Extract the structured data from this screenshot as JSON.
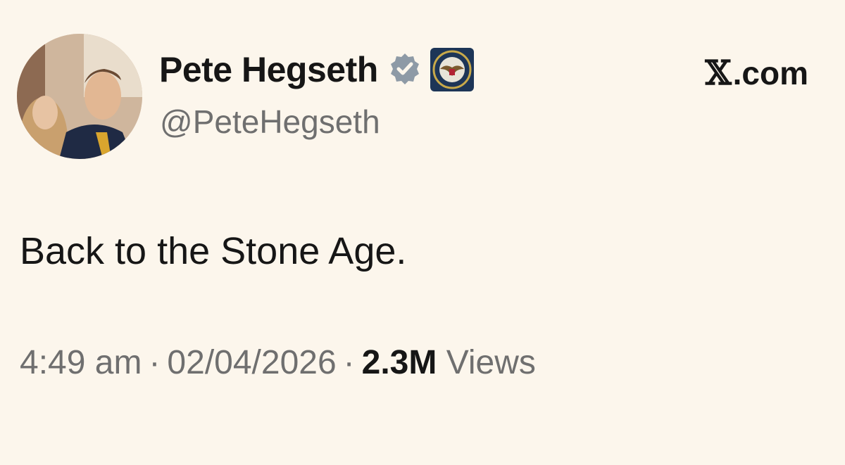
{
  "author": {
    "display_name": "Pete Hegseth",
    "handle": "@PeteHegseth",
    "avatar_icon": "profile-photo",
    "verified_icon": "verified-badge-icon",
    "affiliate_icon": "department-seal-icon"
  },
  "source": {
    "glyph": "𝕏",
    "label": ".com"
  },
  "tweet": {
    "text": "Back to the Stone Age."
  },
  "meta": {
    "time": "4:49 am",
    "separator": "·",
    "date": "02/04/2026",
    "views_count": "2.3M",
    "views_label": "Views"
  },
  "colors": {
    "background": "#fcf6ec",
    "text_primary": "#161616",
    "text_secondary": "#6f6f6f",
    "verified_badge": "#8e9aa6"
  }
}
